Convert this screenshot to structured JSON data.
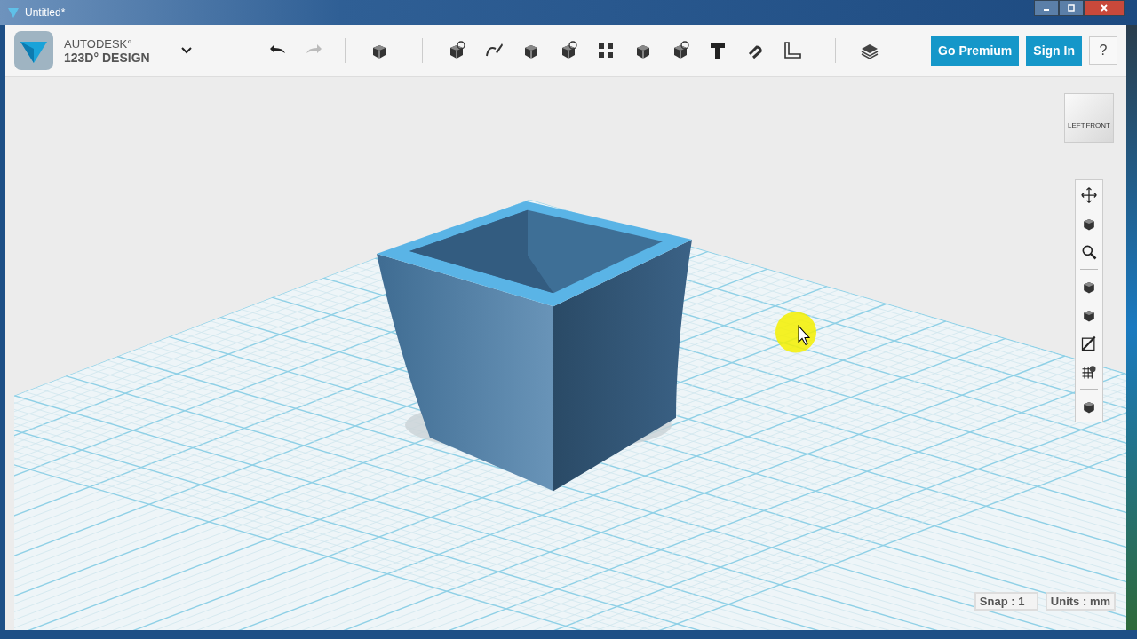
{
  "window": {
    "title": "Untitled*"
  },
  "brand": {
    "line1": "AUTODESK°",
    "line2": "123D° DESIGN"
  },
  "history": [
    {
      "kind": "undo",
      "disabled": false
    },
    {
      "kind": "redo",
      "disabled": true
    }
  ],
  "tools": [
    {
      "kind": "cube"
    },
    {
      "kind": "cube"
    },
    {
      "kind": "pen"
    },
    {
      "kind": "cube"
    },
    {
      "kind": "cube"
    },
    {
      "kind": "grid"
    },
    {
      "kind": "cube"
    },
    {
      "kind": "cube"
    },
    {
      "kind": "text"
    },
    {
      "kind": "magnet"
    },
    {
      "kind": "ruler"
    },
    {
      "kind": "stack"
    }
  ],
  "account": {
    "premium": "Go Premium",
    "sign_in": "Sign In",
    "help": "?"
  },
  "view_cube": {
    "left": "LEFT",
    "front": "FRONT"
  },
  "nav_tools": [
    {
      "kind": "move"
    },
    {
      "kind": "cube"
    },
    {
      "kind": "search"
    },
    {
      "kind": "cube"
    },
    {
      "kind": "cube"
    },
    {
      "kind": "pen"
    },
    {
      "kind": "grid"
    },
    {
      "kind": "cube"
    }
  ],
  "status": {
    "snap": "Snap : 1",
    "units": "Units : mm"
  }
}
